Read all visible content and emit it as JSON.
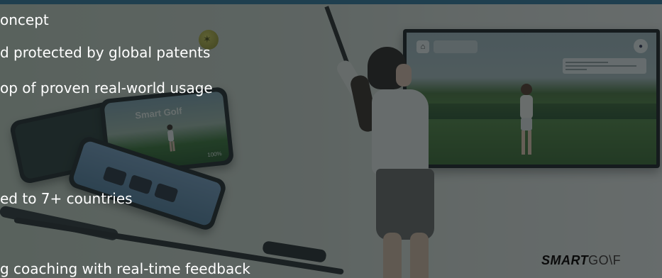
{
  "slide": {
    "lines": [
      "oncept",
      "d protected by global patents",
      "op of proven real-world usage",
      "ed to 7+ countries",
      "g coaching with real-time feedback"
    ]
  },
  "phone": {
    "app_name": "Smart Golf",
    "battery": "100%"
  },
  "logo": {
    "bold": "SMART",
    "light": "GO\\F"
  },
  "colors": {
    "overlay": "#121a1c",
    "topbar": "#1f3f4f",
    "text": "#ffffff"
  }
}
